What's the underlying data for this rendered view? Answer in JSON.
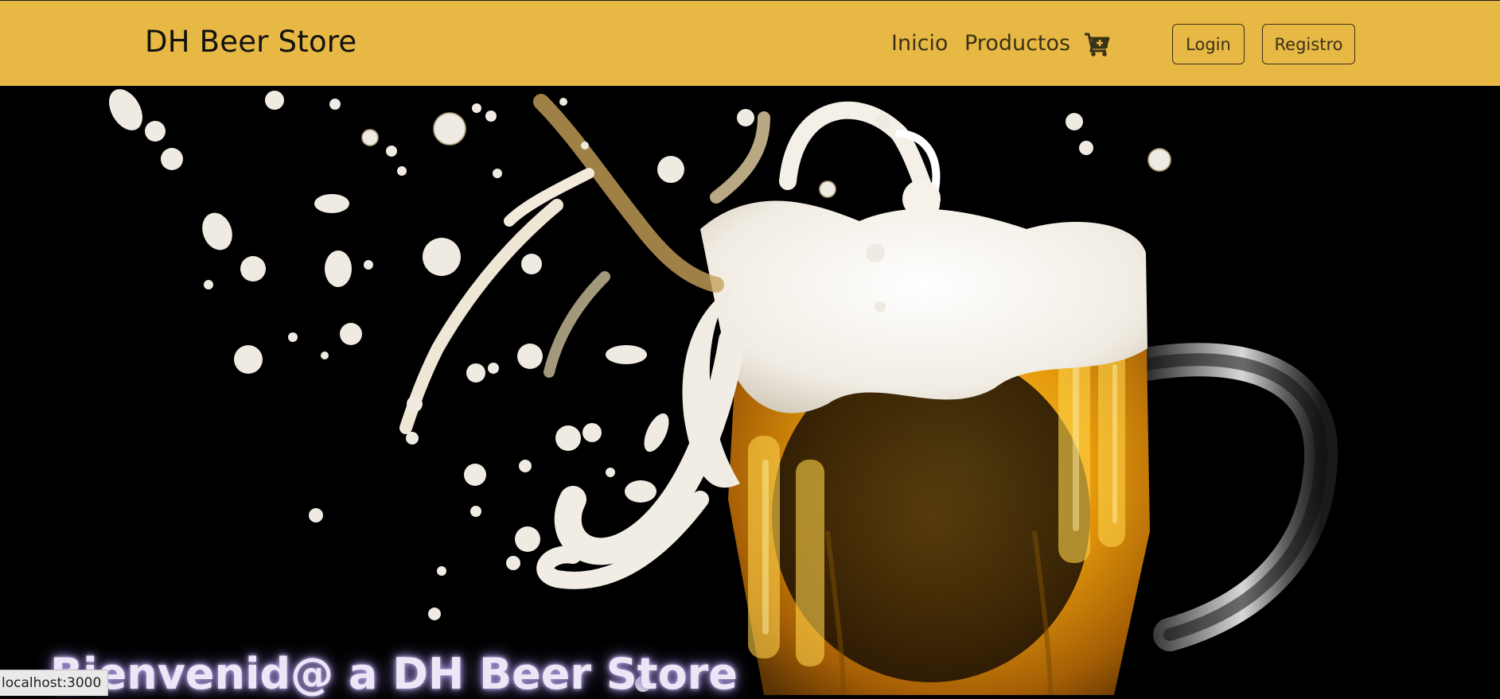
{
  "navbar": {
    "brand": "DH Beer Store",
    "links": [
      {
        "label": "Inicio"
      },
      {
        "label": "Productos"
      }
    ],
    "cart_icon": "cart-plus-icon",
    "login_label": "Login",
    "register_label": "Registro",
    "background_color": "#e8b844"
  },
  "hero": {
    "image": "beer-mug-splash-image",
    "title": "Bienvenid@ a DH Beer Store"
  },
  "status_bar": {
    "url": "localhost:3000"
  }
}
